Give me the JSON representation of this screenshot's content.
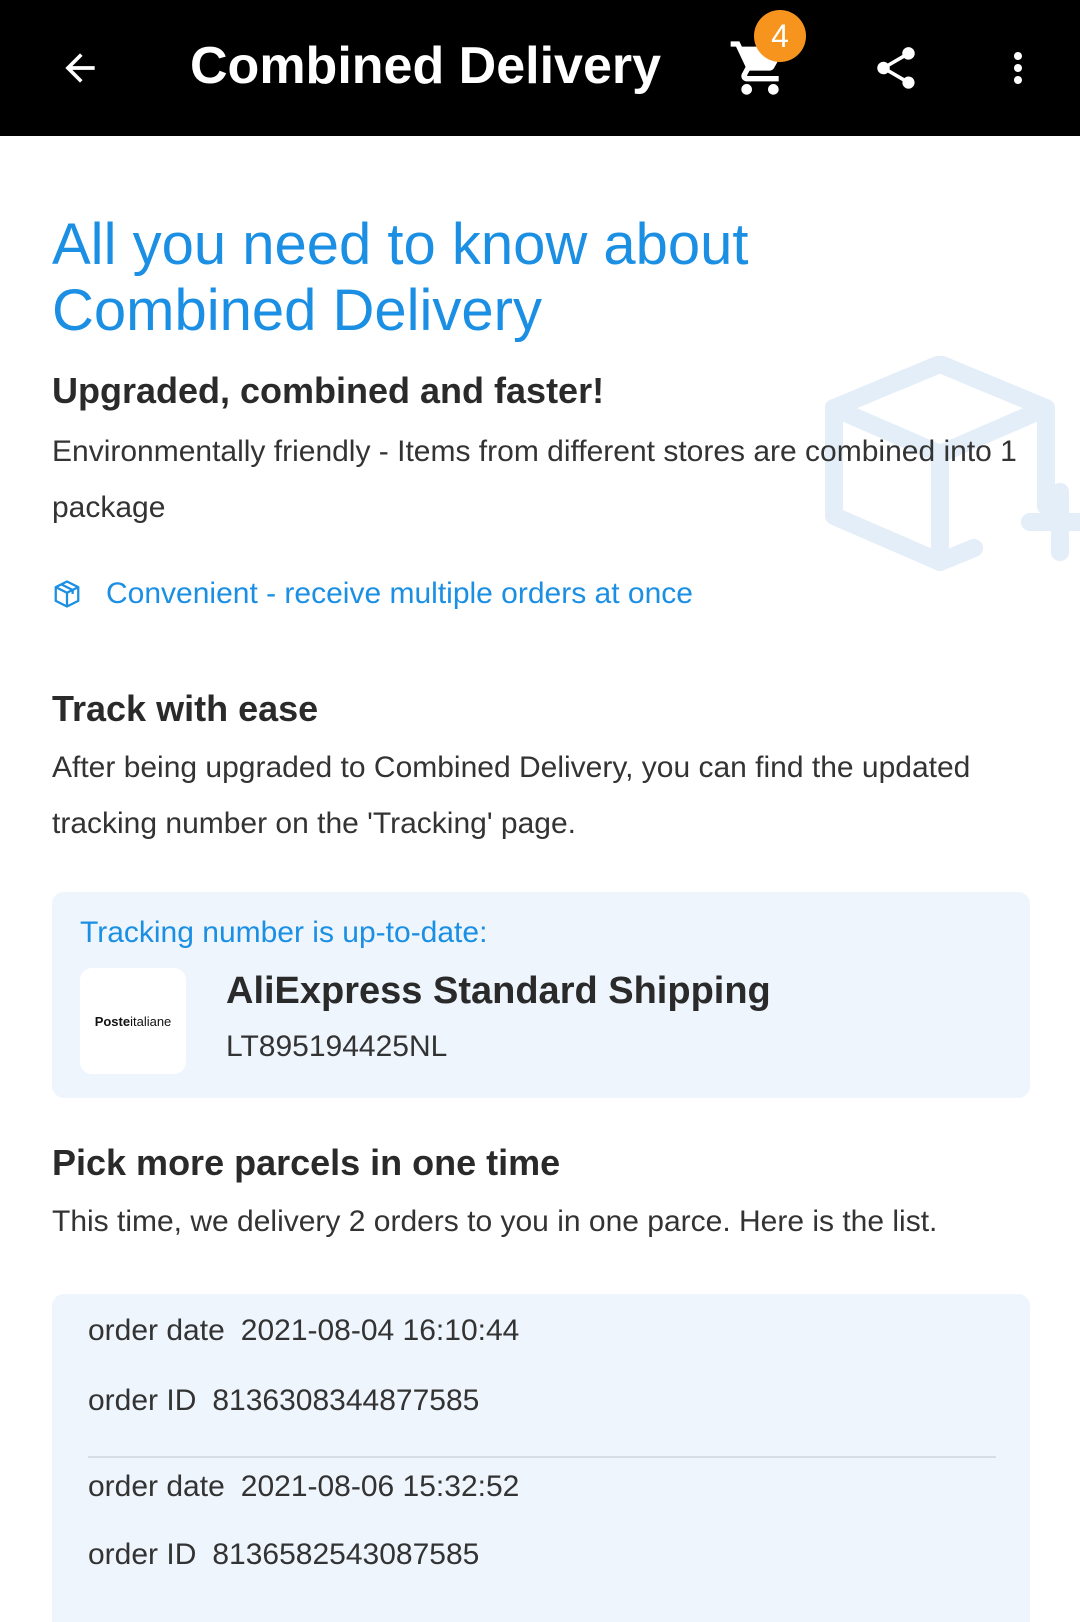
{
  "header": {
    "title": "Combined Delivery",
    "cart_count": "4",
    "icons": [
      "back-arrow-icon",
      "cart-icon",
      "share-icon",
      "more-vert-icon"
    ]
  },
  "hero": {
    "title": "All you need to know about Combined Delivery"
  },
  "section1": {
    "heading": "Upgraded, combined and faster!",
    "body": "Environmentally friendly - Items from different stores are combined into 1 package",
    "perk": "Convenient - receive multiple orders at once"
  },
  "section2": {
    "heading": "Track with ease",
    "body": "After being upgraded to Combined Delivery, you can find the updated tracking number on the 'Tracking' page."
  },
  "tracking_card": {
    "label": "Tracking number is up-to-date:",
    "logo_bold": "Poste",
    "logo_rest": "italiane",
    "carrier": "AliExpress Standard Shipping",
    "number": "LT895194425NL"
  },
  "section3": {
    "heading": "Pick more parcels in one time",
    "body": "This time, we delivery 2 orders to you in one parce. Here is the list."
  },
  "orders": [
    {
      "date_label": "order date",
      "date": "2021-08-04 16:10:44",
      "id_label": "order ID",
      "id": "8136308344877585"
    },
    {
      "date_label": "order date",
      "date": "2021-08-06 15:32:52",
      "id_label": "order ID",
      "id": "8136582543087585"
    }
  ],
  "colors": {
    "accent": "#1a8fe3",
    "badge": "#f7941d",
    "card_bg": "#eef5fd"
  }
}
